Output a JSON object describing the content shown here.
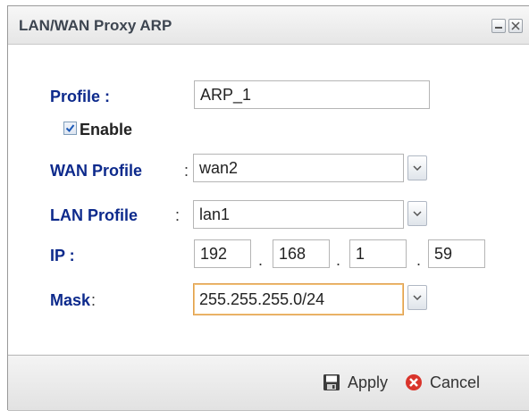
{
  "dialog": {
    "title": "LAN/WAN Proxy ARP"
  },
  "form": {
    "profile_label": "Profile :",
    "profile_value": "ARP_1",
    "enable_label": "Enable",
    "enable_checked": true,
    "wan_profile_label": "WAN Profile",
    "wan_profile_value": "wan2",
    "lan_profile_label": "LAN Profile",
    "lan_profile_value": "lan1",
    "colon": ":",
    "ip_label": "IP :",
    "ip_octets": [
      "192",
      "168",
      "1",
      "59"
    ],
    "ip_dot": ".",
    "mask_label": "Mask",
    "mask_value": "255.255.255.0/24"
  },
  "footer": {
    "apply_label": "Apply",
    "cancel_label": "Cancel"
  },
  "colors": {
    "label": "#0d2a8c",
    "focus_border": "#e0a050",
    "cancel_icon": "#d9342b"
  }
}
